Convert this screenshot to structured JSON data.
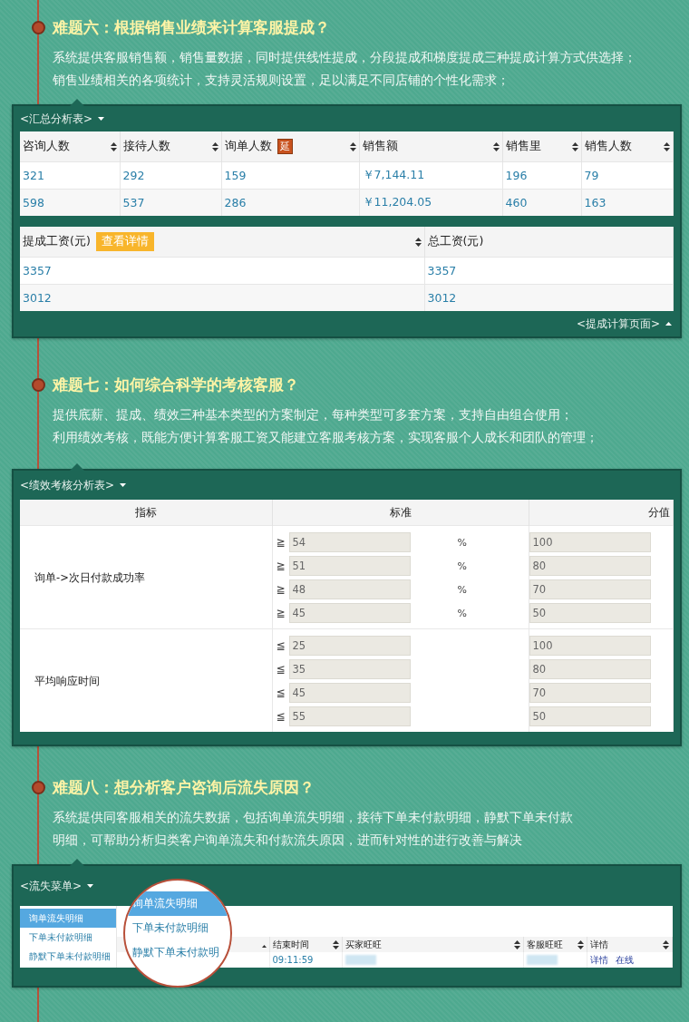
{
  "sections": [
    {
      "title": "难题六：根据销售业绩来计算客服提成？",
      "description": [
        "系统提供客服销售额，销售量数据，同时提供线性提成，分段提成和梯度提成三种提成计算方式供选择；",
        "销售业绩相关的各项统计，支持灵活规则设置，足以满足不同店铺的个性化需求；"
      ],
      "panel": {
        "kind": "tables",
        "title": "<汇总分析表>",
        "tables": [
          {
            "columns": [
              {
                "label": "咨询人数"
              },
              {
                "label": "接待人数"
              },
              {
                "label": "询单人数",
                "badge": "延"
              },
              {
                "label": "销售额"
              },
              {
                "label": "销售里"
              },
              {
                "label": "销售人数"
              }
            ],
            "rows": [
              [
                "321",
                "292",
                "159",
                "￥7,144.11",
                "196",
                "79"
              ],
              [
                "598",
                "537",
                "286",
                "￥11,204.05",
                "460",
                "163"
              ]
            ]
          },
          {
            "columns": [
              {
                "label": "提成工资(元)",
                "button": "查看详情"
              },
              {
                "label": "总工资(元)"
              }
            ],
            "rows": [
              [
                "3357",
                "3357"
              ],
              [
                "3012",
                "3012"
              ]
            ]
          }
        ],
        "footer_link": "<提成计算页面>"
      }
    },
    {
      "title": "难题七：如何综合科学的考核客服？",
      "description": [
        "提供底薪、提成、绩效三种基本类型的方案制定，每种类型可多套方案，支持自由组合使用；",
        "利用绩效考核，既能方便计算客服工资又能建立客服考核方案，实现客服个人成长和团队的管理；"
      ],
      "panel": {
        "kind": "scores",
        "title": "<绩效考核分析表>",
        "columns": [
          "指标",
          "标准",
          "分值"
        ],
        "groups": [
          {
            "indicator": "询单->次日付款成功率",
            "rows": [
              {
                "op": "≧",
                "value": "54",
                "unit": "%",
                "score": "100"
              },
              {
                "op": "≧",
                "value": "51",
                "unit": "%",
                "score": "80"
              },
              {
                "op": "≧",
                "value": "48",
                "unit": "%",
                "score": "70"
              },
              {
                "op": "≧",
                "value": "45",
                "unit": "%",
                "score": "50"
              }
            ]
          },
          {
            "indicator": "平均响应时间",
            "rows": [
              {
                "op": "≦",
                "value": "25",
                "score": "100"
              },
              {
                "op": "≦",
                "value": "35",
                "score": "80"
              },
              {
                "op": "≦",
                "value": "45",
                "score": "70"
              },
              {
                "op": "≦",
                "value": "55",
                "score": "50"
              }
            ]
          }
        ]
      }
    },
    {
      "title": "难题八：想分析客户咨询后流失原因？",
      "description": [
        "系统提供同客服相关的流失数据，包括询单流失明细，接待下单未付款明细，静默下单未付款",
        "明细，可帮助分析归类客户询单流失和付款流失原因，进而针对性的进行改善与解决"
      ],
      "panel": {
        "kind": "menu",
        "title": "<流失菜单>",
        "menu": [
          {
            "label": "询单流失明细",
            "selected": true
          },
          {
            "label": "下单未付款明细",
            "selected": false
          },
          {
            "label": "静默下单未付款明细",
            "selected": false
          }
        ],
        "columns": [
          "结束时间",
          "买家旺旺",
          "客服旺旺",
          "详情"
        ],
        "row": {
          "end_time": "09:11:59",
          "links": [
            "详情",
            "在线"
          ]
        },
        "magnifier": [
          {
            "label": "询单流失明细",
            "selected": true
          },
          {
            "label": "下单未付款明细",
            "selected": false
          },
          {
            "label": "静默下单未付款明",
            "selected": false
          }
        ]
      }
    }
  ]
}
